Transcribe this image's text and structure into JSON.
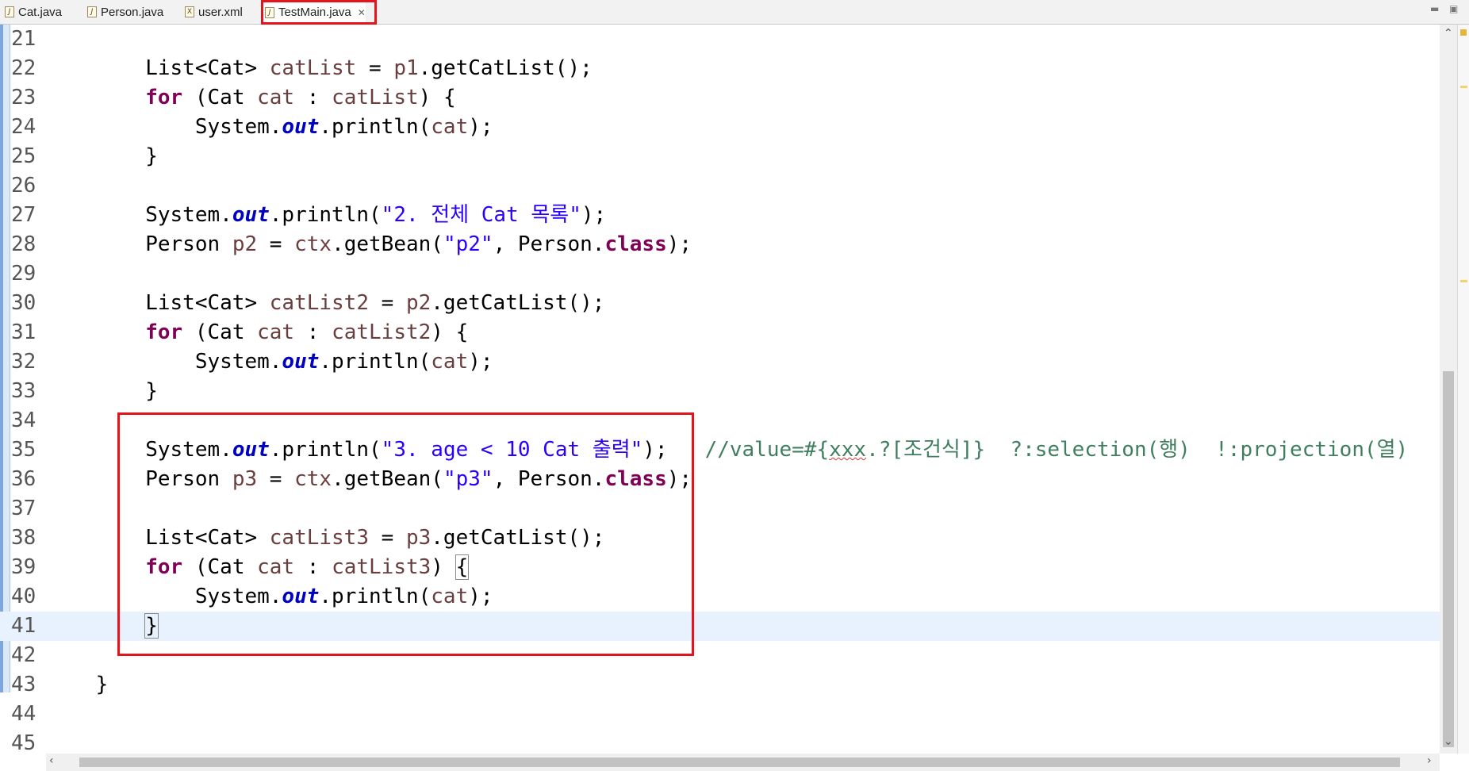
{
  "tabs": [
    {
      "label": "Cat.java",
      "icon": "java-file-icon"
    },
    {
      "label": "Person.java",
      "icon": "java-file-icon"
    },
    {
      "label": "user.xml",
      "icon": "xml-file-icon"
    },
    {
      "label": "TestMain.java",
      "icon": "java-file-icon",
      "active": true
    }
  ],
  "window_controls": {
    "minimize": "▬",
    "maximize": "▣"
  },
  "editor": {
    "lines": [
      {
        "n": "21",
        "text": ""
      },
      {
        "n": "22",
        "text": "List<Cat> catList = p1.getCatList();"
      },
      {
        "n": "23",
        "text": "for (Cat cat : catList) {"
      },
      {
        "n": "24",
        "text": "System.out.println(cat);"
      },
      {
        "n": "25",
        "text": "}"
      },
      {
        "n": "26",
        "text": ""
      },
      {
        "n": "27",
        "text": "System.out.println(\"2. 전체 Cat 목록\");"
      },
      {
        "n": "28",
        "text": "Person p2 = ctx.getBean(\"p2\", Person.class);"
      },
      {
        "n": "29",
        "text": ""
      },
      {
        "n": "30",
        "text": "List<Cat> catList2 = p2.getCatList();"
      },
      {
        "n": "31",
        "text": "for (Cat cat : catList2) {"
      },
      {
        "n": "32",
        "text": "System.out.println(cat);"
      },
      {
        "n": "33",
        "text": "}"
      },
      {
        "n": "34",
        "text": ""
      },
      {
        "n": "35",
        "text": "System.out.println(\"3. age < 10 Cat 출력\");   //value=#{xxx.?[조건식]}  ?:selection(행)  !:projection(열)"
      },
      {
        "n": "36",
        "text": "Person p3 = ctx.getBean(\"p3\", Person.class);"
      },
      {
        "n": "37",
        "text": ""
      },
      {
        "n": "38",
        "text": "List<Cat> catList3 = p3.getCatList();"
      },
      {
        "n": "39",
        "text": "for (Cat cat : catList3) {"
      },
      {
        "n": "40",
        "text": "System.out.println(cat);"
      },
      {
        "n": "41",
        "text": "}",
        "current": true
      },
      {
        "n": "42",
        "text": ""
      },
      {
        "n": "43",
        "text": "}"
      },
      {
        "n": "44",
        "text": ""
      },
      {
        "n": "45",
        "text": ""
      }
    ]
  },
  "annotation_color": "#e3141b",
  "colors": {
    "keyword": "#7f0055",
    "field": "#0000c0",
    "string": "#2a00ff",
    "variable": "#6a3e3e",
    "comment": "#3f7f5f"
  }
}
